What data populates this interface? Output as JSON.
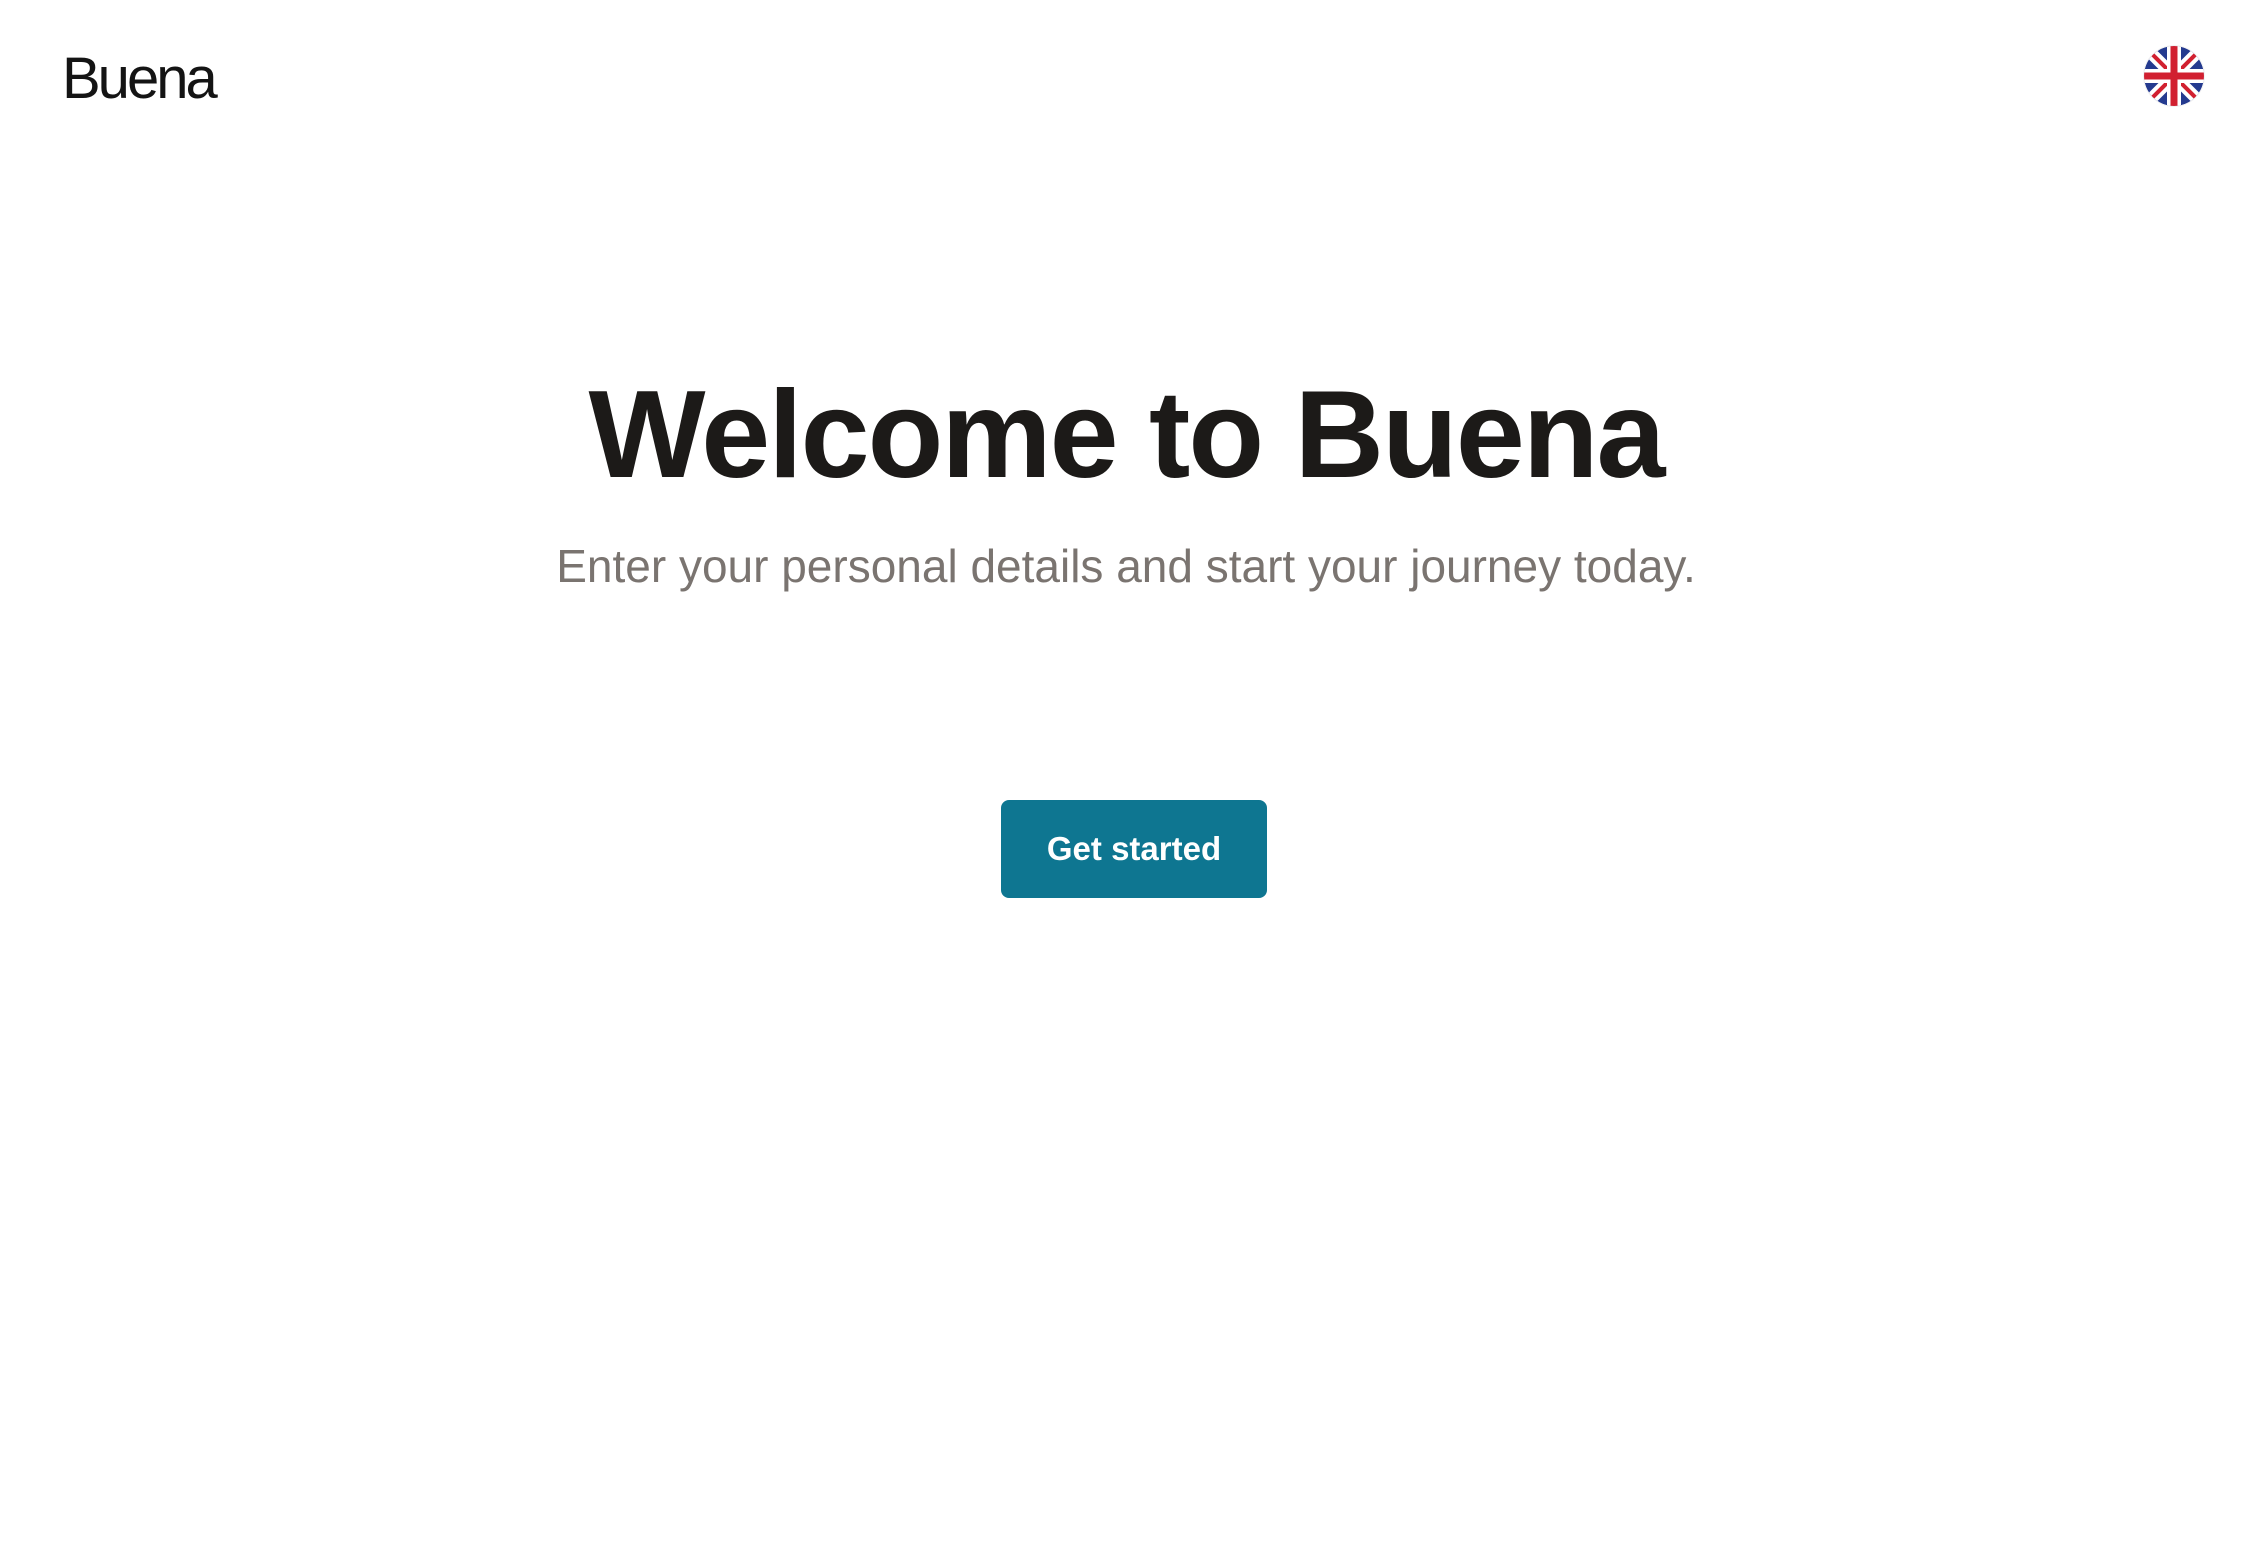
{
  "header": {
    "logo_text": "Buena",
    "language_icon": "uk-flag-icon"
  },
  "hero": {
    "title": "Welcome to Buena",
    "subtitle": "Enter your personal details and start your journey today."
  },
  "cta": {
    "label": "Get started"
  },
  "colors": {
    "primary": "#0e7691",
    "title": "#1c1a18",
    "subtitle": "#7a7470",
    "background": "#ffffff"
  }
}
